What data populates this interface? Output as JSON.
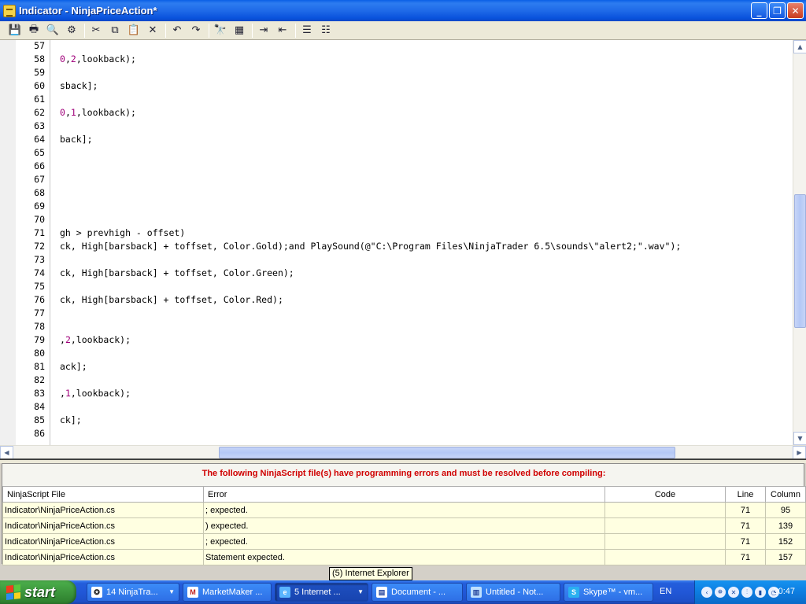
{
  "window": {
    "title": "Indicator - NinjaPriceAction*",
    "minimize": "_",
    "restore": "❐",
    "close": "✕"
  },
  "toolbar": {
    "buttons": [
      {
        "icon": "save-icon",
        "glyph": "💾"
      },
      {
        "icon": "print-icon",
        "glyph": "🖶"
      },
      {
        "icon": "print-preview-icon",
        "glyph": "🔍"
      },
      {
        "icon": "compile-icon",
        "glyph": "⚙"
      },
      {
        "icon": "cut-icon",
        "glyph": "✂"
      },
      {
        "icon": "copy-icon",
        "glyph": "⧉"
      },
      {
        "icon": "paste-icon",
        "glyph": "📋"
      },
      {
        "icon": "delete-icon",
        "glyph": "✕"
      },
      {
        "icon": "undo-icon",
        "glyph": "↶"
      },
      {
        "icon": "redo-icon",
        "glyph": "↷"
      },
      {
        "icon": "find-icon",
        "glyph": "🔭"
      },
      {
        "icon": "replace-icon",
        "glyph": "▦"
      },
      {
        "icon": "indent-icon",
        "glyph": "⇥"
      },
      {
        "icon": "outdent-icon",
        "glyph": "⇤"
      },
      {
        "icon": "comment-icon",
        "glyph": "☰"
      },
      {
        "icon": "uncomment-icon",
        "glyph": "☷"
      }
    ]
  },
  "editor": {
    "lines": [
      {
        "num": "57",
        "text": ""
      },
      {
        "num": "58",
        "text": "0,2,lookback);"
      },
      {
        "num": "59",
        "text": ""
      },
      {
        "num": "60",
        "text": "sback];"
      },
      {
        "num": "61",
        "text": ""
      },
      {
        "num": "62",
        "text": "0,1,lookback);"
      },
      {
        "num": "63",
        "text": ""
      },
      {
        "num": "64",
        "text": "back];"
      },
      {
        "num": "65",
        "text": ""
      },
      {
        "num": "66",
        "text": ""
      },
      {
        "num": "67",
        "text": ""
      },
      {
        "num": "68",
        "text": ""
      },
      {
        "num": "69",
        "text": ""
      },
      {
        "num": "70",
        "text": ""
      },
      {
        "num": "71",
        "text": "gh > prevhigh - offset)"
      },
      {
        "num": "72",
        "text": "ck, High[barsback] + toffset, Color.Gold);and PlaySound(@\"C:\\Program Files\\NinjaTrader 6.5\\sounds\\\"alert2;\".wav\");"
      },
      {
        "num": "73",
        "text": ""
      },
      {
        "num": "74",
        "text": "ck, High[barsback] + toffset, Color.Green);"
      },
      {
        "num": "75",
        "text": ""
      },
      {
        "num": "76",
        "text": "ck, High[barsback] + toffset, Color.Red);"
      },
      {
        "num": "77",
        "text": ""
      },
      {
        "num": "78",
        "text": ""
      },
      {
        "num": "79",
        "text": ",2,lookback);"
      },
      {
        "num": "80",
        "text": ""
      },
      {
        "num": "81",
        "text": "ack];"
      },
      {
        "num": "82",
        "text": ""
      },
      {
        "num": "83",
        "text": ",1,lookback);"
      },
      {
        "num": "84",
        "text": ""
      },
      {
        "num": "85",
        "text": "ck];"
      },
      {
        "num": "86",
        "text": ""
      }
    ]
  },
  "errors": {
    "message": "The following NinjaScript file(s) have programming errors and must be resolved before compiling:",
    "columns": [
      "NinjaScript File",
      "Error",
      "Code",
      "Line",
      "Column"
    ],
    "rows": [
      [
        "Indicator\\NinjaPriceAction.cs",
        "; expected.",
        "",
        "71",
        "95"
      ],
      [
        "Indicator\\NinjaPriceAction.cs",
        ") expected.",
        "",
        "71",
        "139"
      ],
      [
        "Indicator\\NinjaPriceAction.cs",
        "; expected.",
        "",
        "71",
        "152"
      ],
      [
        "Indicator\\NinjaPriceAction.cs",
        "Statement expected.",
        "",
        "71",
        "157"
      ]
    ]
  },
  "tooltip": "(5) Internet Explorer",
  "taskbar": {
    "start_label": "start",
    "tasks": [
      {
        "label": "14 NinjaTra...",
        "icon": "ninjatrader-icon",
        "has_arrow": true
      },
      {
        "label": "MarketMaker ...",
        "icon": "gmail-icon",
        "has_arrow": false
      },
      {
        "label": "5 Internet ...",
        "icon": "internet-explorer-icon",
        "has_arrow": true,
        "active": true
      },
      {
        "label": "Document - ...",
        "icon": "document-icon",
        "has_arrow": false
      },
      {
        "label": "Untitled - Not...",
        "icon": "notepad-icon",
        "has_arrow": false
      },
      {
        "label": "Skype™ - vm...",
        "icon": "skype-icon",
        "has_arrow": false
      }
    ],
    "language": "EN",
    "clock": "20:47"
  }
}
